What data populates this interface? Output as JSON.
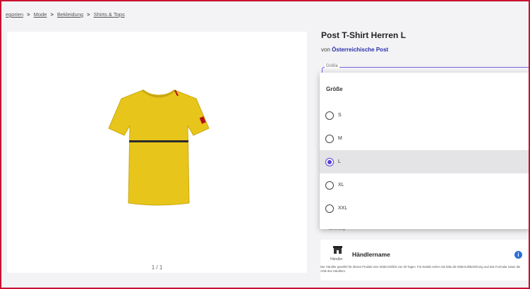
{
  "breadcrumb": {
    "items": [
      "egorien",
      "Mode",
      "Bekleidung",
      "Shirts & Tops"
    ],
    "separator": ">"
  },
  "gallery": {
    "image_name": "yellow-tshirt",
    "counter": "1 / 1"
  },
  "product": {
    "title": "Post T-Shirt Herren L",
    "seller_prefix": "von",
    "seller_name": "Österreichische Post"
  },
  "size_select": {
    "legend": "Größe",
    "header": "Größe",
    "options": [
      {
        "label": "S",
        "selected": false
      },
      {
        "label": "M",
        "selected": false
      },
      {
        "label": "L",
        "selected": true
      },
      {
        "label": "XL",
        "selected": false
      },
      {
        "label": "XXL",
        "selected": false
      }
    ]
  },
  "delivery": {
    "label": "Lieferung"
  },
  "merchant": {
    "tag": "Händler",
    "name": "Händlername",
    "description": "Der Händler gewährt für dieses Produkt eine Widerrufsfrist von 30 Tagen. Für Details sehen Sie bitte die Widerrufsbelehrung und das Formular sowie die AGB des Händlers."
  },
  "colors": {
    "accent": "#5a3fd6",
    "link": "#2a2fa8",
    "info": "#2b6fd6",
    "frame": "#c8102e",
    "shirt": "#e8c51a"
  }
}
